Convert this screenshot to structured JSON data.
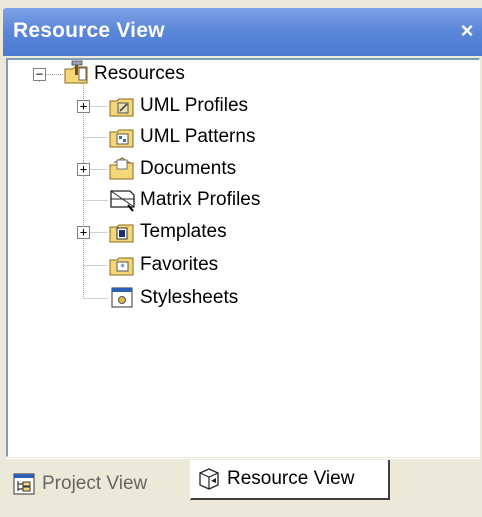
{
  "window": {
    "title": "Resource View",
    "close_glyph": "×"
  },
  "tree": {
    "root": {
      "label": "Resources",
      "icon": "resources-folder-icon",
      "expanded": true
    },
    "children": [
      {
        "label": "UML Profiles",
        "icon": "uml-profiles-icon",
        "expandable": true
      },
      {
        "label": "UML Patterns",
        "icon": "uml-patterns-icon",
        "expandable": false
      },
      {
        "label": "Documents",
        "icon": "documents-icon",
        "expandable": true
      },
      {
        "label": "Matrix Profiles",
        "icon": "matrix-profiles-icon",
        "expandable": false
      },
      {
        "label": "Templates",
        "icon": "templates-icon",
        "expandable": true
      },
      {
        "label": "Favorites",
        "icon": "favorites-icon",
        "expandable": false
      },
      {
        "label": "Stylesheets",
        "icon": "stylesheets-icon",
        "expandable": false
      }
    ]
  },
  "tabs": [
    {
      "label": "Project View",
      "icon": "project-view-icon",
      "active": false
    },
    {
      "label": "Resource View",
      "icon": "resource-view-icon",
      "active": true
    }
  ],
  "colors": {
    "titlebar": "#5A86D8",
    "window_bg": "#ECE9D8",
    "folder": "#F5D77A",
    "tree_line": "#A0A0A0"
  }
}
